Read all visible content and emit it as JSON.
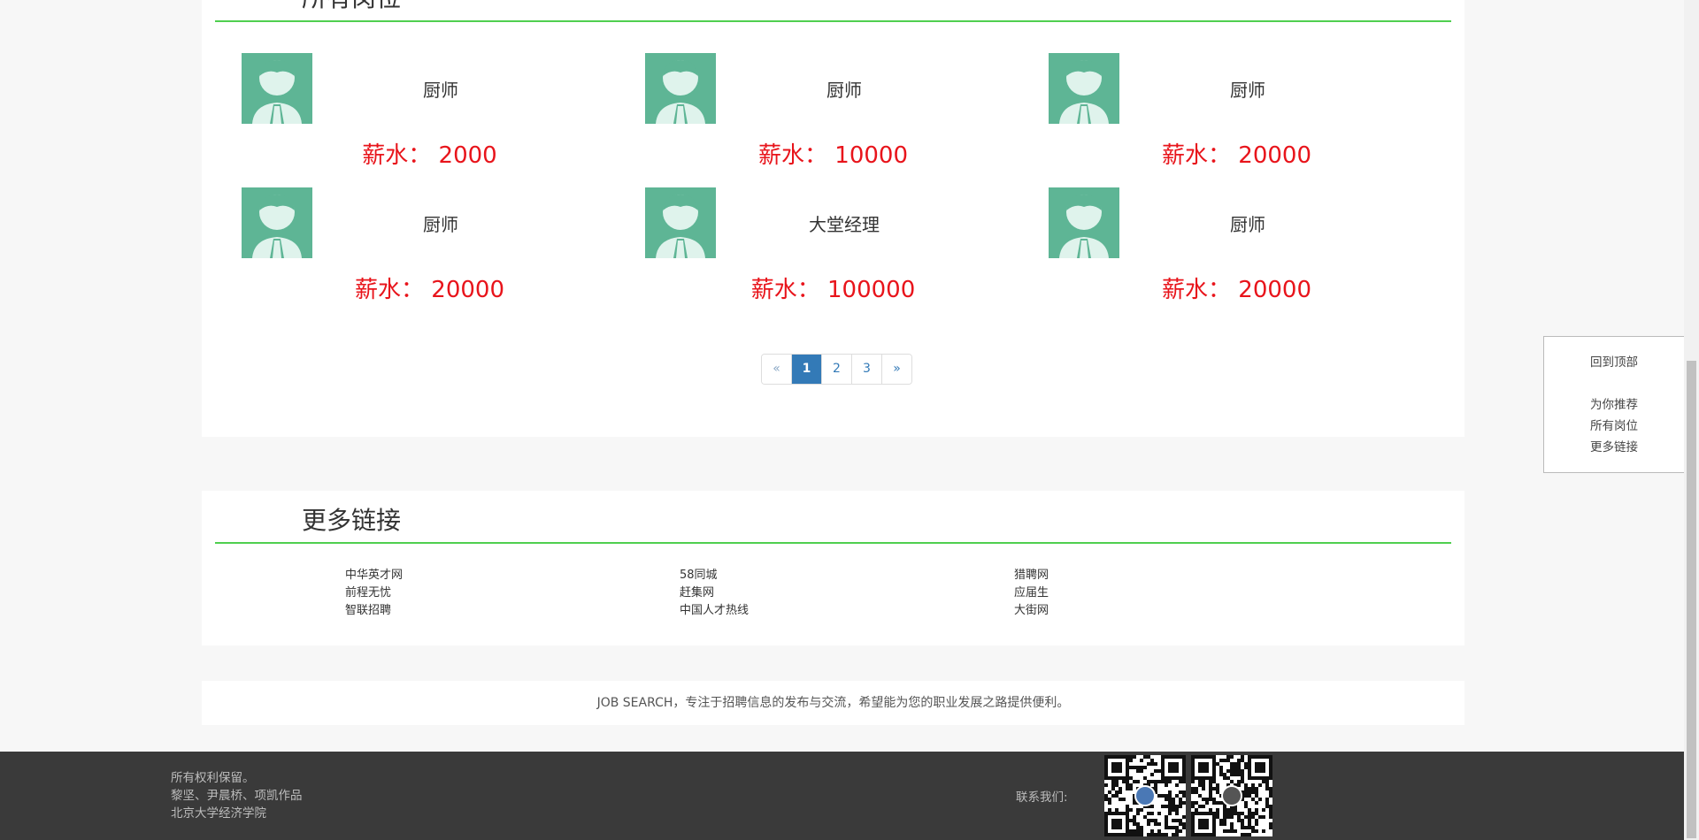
{
  "jobs_section": {
    "title": "所有岗位",
    "jobs": [
      {
        "title": "厨师",
        "salary_label": "薪水：",
        "salary": "2000"
      },
      {
        "title": "厨师",
        "salary_label": "薪水：",
        "salary": "10000"
      },
      {
        "title": "厨师",
        "salary_label": "薪水：",
        "salary": "20000"
      },
      {
        "title": "厨师",
        "salary_label": "薪水：",
        "salary": "20000"
      },
      {
        "title": "大堂经理",
        "salary_label": "薪水：",
        "salary": "100000"
      },
      {
        "title": "厨师",
        "salary_label": "薪水：",
        "salary": "20000"
      }
    ],
    "pagination": {
      "prev": "«",
      "pages": [
        "1",
        "2",
        "3"
      ],
      "active": "1",
      "next": "»"
    }
  },
  "links_section": {
    "title": "更多链接",
    "columns": [
      [
        "中华英才网",
        "前程无忧",
        "智联招聘"
      ],
      [
        "58同城",
        "赶集网",
        "中国人才热线"
      ],
      [
        "猎聘网",
        "应届生",
        "大街网"
      ]
    ]
  },
  "slogan": "JOB SEARCH，专注于招聘信息的发布与交流，希望能为您的职业发展之路提供便利。",
  "footer": {
    "lines": [
      "所有权利保留。",
      "黎坚、尹晨桥、项凯作品",
      "北京大学经济学院"
    ],
    "contact_label": "联系我们:"
  },
  "side_nav": {
    "back_to_top": "回到顶部",
    "items": [
      "为你推荐",
      "所有岗位",
      "更多链接"
    ]
  },
  "colors": {
    "accent_green": "#4fcf4f",
    "salary_red": "#e8141b",
    "avatar_green": "#5eb595",
    "pager_blue": "#337ab7"
  },
  "icons": {
    "job_avatar": "person-avatar-icon",
    "qr": "qr-code-icon"
  }
}
